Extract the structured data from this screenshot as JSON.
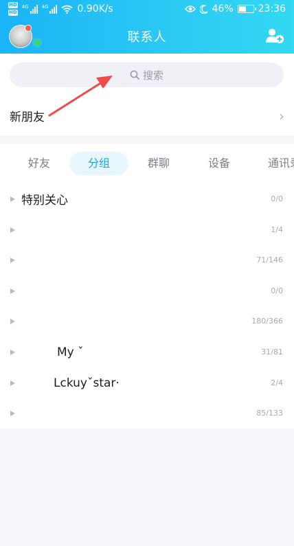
{
  "status_bar": {
    "hd_top": "HD",
    "hd_bottom": "HD",
    "net_1": "4G",
    "net_2": "4G",
    "speed": "0.90K/s",
    "battery": "46%",
    "battery_level": 0.46,
    "time": "23:36",
    "icons": [
      "eye-icon",
      "moon-icon",
      "battery-icon",
      "wifi-icon"
    ]
  },
  "header": {
    "title": "联系人",
    "colors": {
      "gradient_start": "#1ab4f8",
      "gradient_end": "#33d9f2"
    }
  },
  "search": {
    "placeholder": "搜索"
  },
  "new_friend": {
    "label": "新朋友",
    "chevron": "›"
  },
  "tabs": [
    {
      "label": "好友",
      "active": false
    },
    {
      "label": "分组",
      "active": true
    },
    {
      "label": "群聊",
      "active": false
    },
    {
      "label": "设备",
      "active": false
    },
    {
      "label": "通讯录",
      "active": false
    }
  ],
  "groups": [
    {
      "name": "特别关心",
      "count": "0/0"
    },
    {
      "name": "",
      "count": "1/4"
    },
    {
      "name": "",
      "count": "71/146"
    },
    {
      "name": "",
      "count": "0/0"
    },
    {
      "name": "",
      "count": "180/366"
    },
    {
      "name": "My ˇ",
      "count": "31/81"
    },
    {
      "name": "Lckuyˇstar·",
      "count": "2/4"
    },
    {
      "name": "",
      "count": "85/133"
    }
  ],
  "colors": {
    "accent": "#1aa9ef",
    "annotation_arrow": "#ef4b4b",
    "online": "#3dd374"
  }
}
